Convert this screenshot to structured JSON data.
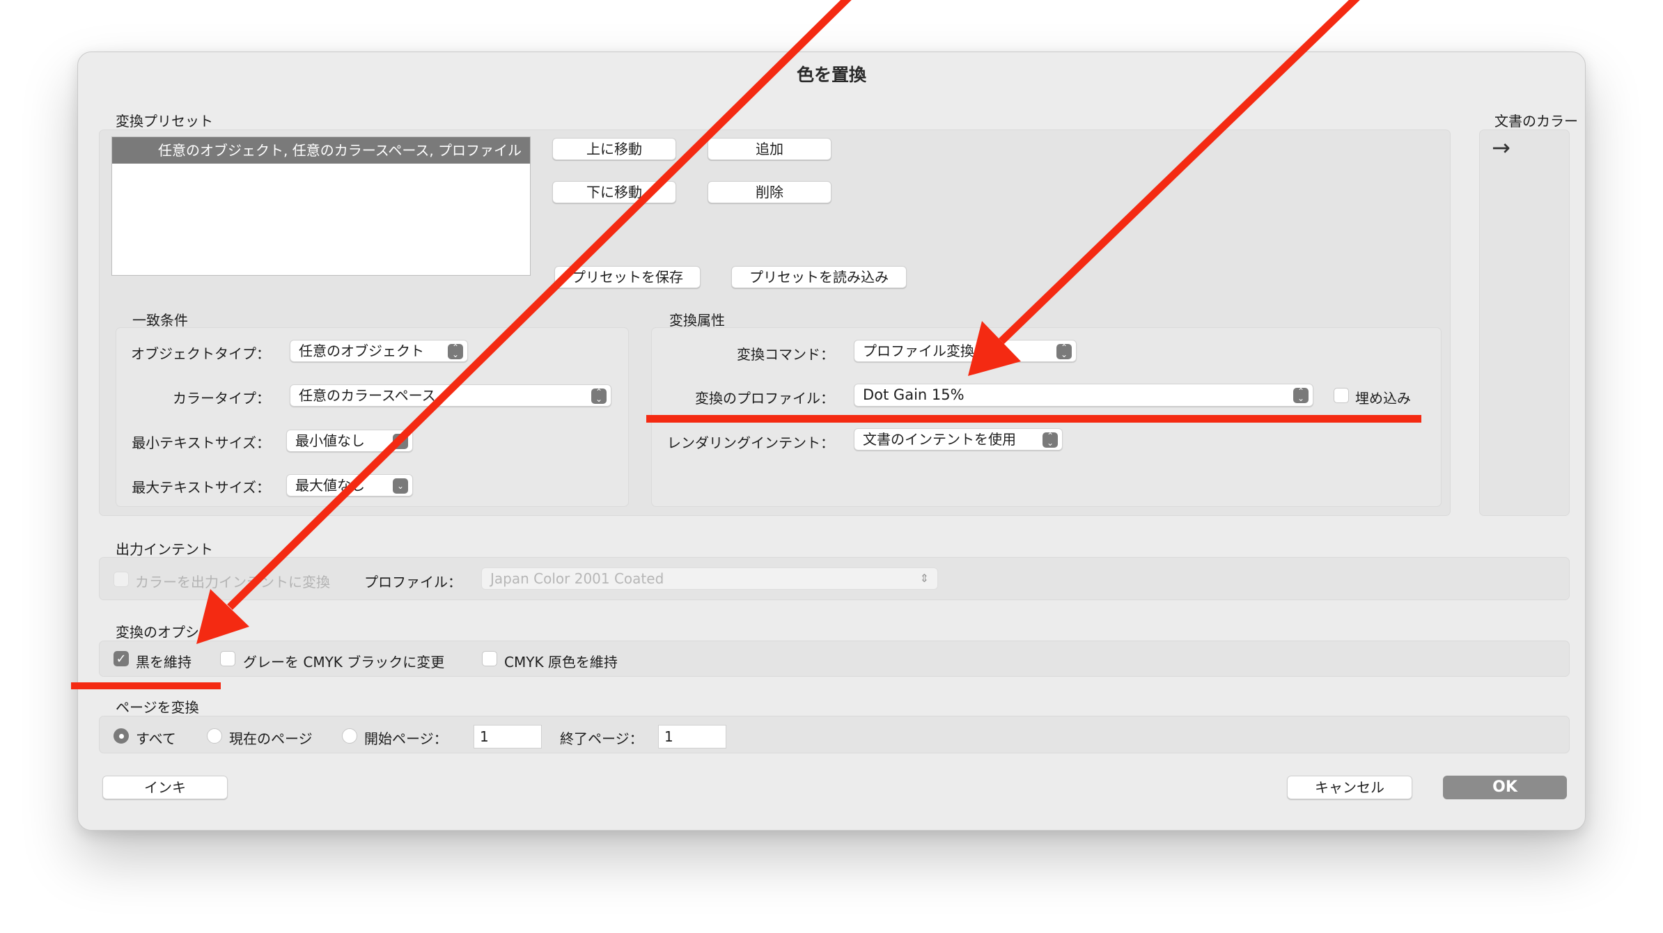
{
  "window": {
    "title": "色を置換"
  },
  "presets": {
    "section_label": "変換プリセット",
    "list_items": [
      "任意のオブジェクト, 任意のカラースペース, プロファイル"
    ],
    "move_up": "上に移動",
    "move_down": "下に移動",
    "add": "追加",
    "delete": "削除",
    "save": "プリセットを保存",
    "load": "プリセットを読み込み"
  },
  "document_colors": {
    "label": "文書のカラー",
    "arrow": "→"
  },
  "match": {
    "section_label": "一致条件",
    "object_type_label": "オブジェクトタイプ：",
    "object_type_value": "任意のオブジェクト",
    "color_type_label": "カラータイプ：",
    "color_type_value": "任意のカラースペース",
    "min_text_label": "最小テキストサイズ：",
    "min_text_value": "最小値なし",
    "max_text_label": "最大テキストサイズ：",
    "max_text_value": "最大値なし"
  },
  "convert": {
    "section_label": "変換属性",
    "command_label": "変換コマンド：",
    "command_value": "プロファイル変換",
    "profile_label": "変換のプロファイル：",
    "profile_value": "Dot Gain 15%",
    "embed_label": "埋め込み",
    "intent_label": "レンダリングインテント：",
    "intent_value": "文書のインテントを使用"
  },
  "output_intent": {
    "section_label": "出力インテント",
    "convert_checkbox": "カラーを出力インテントに変換",
    "profile_label": "プロファイル：",
    "profile_value": "Japan Color 2001 Coated"
  },
  "options": {
    "section_label": "変換のオプション",
    "keep_black": "黒を維持",
    "gray_to_black": "グレーを CMYK ブラックに変更",
    "keep_cmyk": "CMYK 原色を維持"
  },
  "pages": {
    "section_label": "ページを変換",
    "all": "すべて",
    "current": "現在のページ",
    "start_label": "開始ページ：",
    "start_value": "1",
    "end_label": "終了ページ：",
    "end_value": "1"
  },
  "footer": {
    "ink": "インキ",
    "cancel": "キャンセル",
    "ok": "OK"
  },
  "annotation": {
    "color": "#f42a12"
  }
}
